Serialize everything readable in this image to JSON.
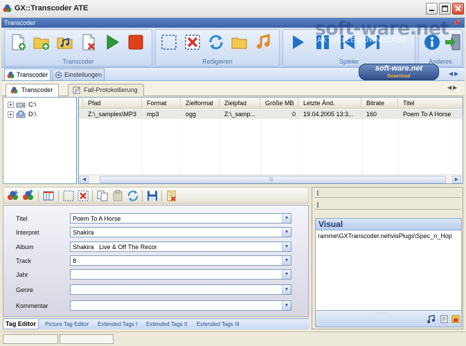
{
  "window": {
    "title": "GX::Transcoder ATE",
    "controls": [
      "minimize",
      "maximize",
      "close"
    ]
  },
  "ribbon": {
    "header": "Transcoder",
    "groups": [
      {
        "label": "Transcoder",
        "buttons": [
          "new-file-icon",
          "add-folder-icon",
          "add-music-icon",
          "remove-file-icon",
          "play-icon",
          "stop-icon"
        ]
      },
      {
        "label": "Redigieren",
        "buttons": [
          "select-icon",
          "delete-icon",
          "refresh-icon",
          "folder-icon",
          "music-note-icon"
        ]
      },
      {
        "label": "Spieler",
        "buttons": [
          "play-icon",
          "pause-icon",
          "previous-icon",
          "next-icon"
        ]
      },
      {
        "label": "Anderes",
        "buttons": [
          "info-icon",
          "exit-icon"
        ]
      }
    ]
  },
  "watermark": {
    "text": "soft-ware.net",
    "sub": "AKTUELLE DOWNLOADS",
    "badge_main": "soft-ware.net",
    "badge_sub": "Download"
  },
  "mode_tabs": [
    {
      "label": "Transcoder",
      "icon": "transcoder-icon",
      "active": true
    },
    {
      "label": "Einstellungen",
      "icon": "settings-icon",
      "active": false
    }
  ],
  "doc_tabs": [
    {
      "label": "Transcoder",
      "icon": "transcoder-icon",
      "active": true
    },
    {
      "label": "Fall-Protokollierung",
      "icon": "log-icon",
      "active": false
    }
  ],
  "tree": {
    "items": [
      {
        "label": "C:\\",
        "icon": "drive-icon"
      },
      {
        "label": "D:\\",
        "icon": "cd-drive-icon"
      }
    ]
  },
  "file_list": {
    "columns": [
      "Pfad",
      "Format",
      "Zielformat",
      "Zielpfad",
      "Größe MB",
      "Letzte Änd.",
      "Bitrate",
      "Titel"
    ],
    "rows": [
      [
        "Z:\\_samples\\MP3",
        "mp3",
        "ogg",
        "Z:\\_samp...",
        "0",
        "19.04.2005 13:3...",
        "160",
        "Poem To A Horse"
      ]
    ]
  },
  "tag_editor": {
    "fields": [
      {
        "label": "Titel",
        "value": "Poem To A Horse"
      },
      {
        "label": "Interpret",
        "value": "Shakira"
      },
      {
        "label": "Album",
        "value": "Shakira   Live & Off The Recor"
      },
      {
        "label": "Track",
        "value": "8"
      },
      {
        "label": "Jahr",
        "value": ""
      },
      {
        "label": "Genre",
        "value": ""
      },
      {
        "label": "Kommentar",
        "value": ""
      }
    ],
    "tabs": [
      "Tag Editor",
      "Picture Tag Editor",
      "Extended Tags I",
      "Extended Tags II",
      "Extended Tags III"
    ]
  },
  "visual": {
    "title": "Visual",
    "path": "ramme\\GXTranscoder.net\\visPlugs\\Spec_n_Hop"
  },
  "colors": {
    "ribbon_blue": "#3B62A8",
    "selection_gray": "#E8E8E4",
    "accent_play": "#2E9A3A",
    "accent_stop": "#E0401E"
  }
}
